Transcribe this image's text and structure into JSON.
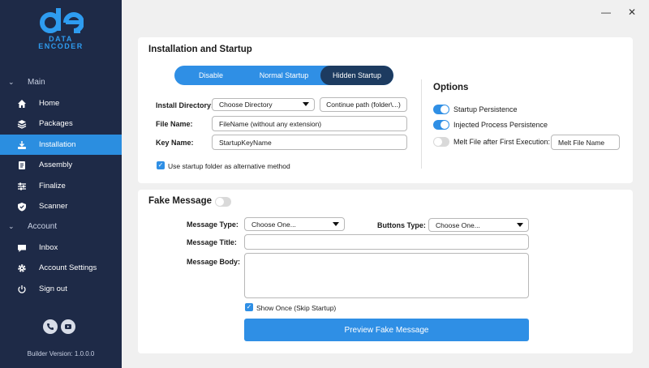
{
  "sidebar": {
    "logo_text_line1": "DATA",
    "logo_text_line2": "ENCODER",
    "section_main": "Main",
    "section_account": "Account",
    "items": [
      {
        "label": "Home",
        "icon": "home-icon"
      },
      {
        "label": "Packages",
        "icon": "layers-icon"
      },
      {
        "label": "Installation",
        "icon": "install-icon"
      },
      {
        "label": "Assembly",
        "icon": "document-icon"
      },
      {
        "label": "Finalize",
        "icon": "sliders-icon"
      },
      {
        "label": "Scanner",
        "icon": "shield-icon"
      }
    ],
    "account_items": [
      {
        "label": "Inbox",
        "icon": "chat-icon"
      },
      {
        "label": "Account Settings",
        "icon": "gear-icon"
      },
      {
        "label": "Sign out",
        "icon": "power-icon"
      }
    ],
    "version": "Builder Version: 1.0.0.0",
    "active_item": "Installation"
  },
  "install": {
    "title": "Installation and Startup",
    "startup_modes": [
      "Disable",
      "Normal Startup",
      "Hidden Startup"
    ],
    "selected_mode": "Hidden Startup",
    "install_directory_label": "Install Directory:",
    "install_directory_value": "Choose Directory",
    "continue_path_label": "Continue path (folder\\...)",
    "file_name_label": "File Name:",
    "file_name_value": "FileName (without any extension)",
    "key_name_label": "Key Name:",
    "key_name_value": "StartupKeyName",
    "startup_folder_label": "Use startup folder as alternative method",
    "startup_folder_checked": true
  },
  "options": {
    "title": "Options",
    "startup_persistence_label": "Startup Persistence",
    "startup_persistence_on": true,
    "injected_persistence_label": "Injected Process Persistence",
    "injected_persistence_on": true,
    "melt_label": "Melt File after First Execution:",
    "melt_on": false,
    "melt_name_value": "Melt File Name"
  },
  "fake_message": {
    "title": "Fake Message",
    "enabled": false,
    "message_type_label": "Message Type:",
    "message_type_value": "Choose One...",
    "buttons_type_label": "Buttons Type:",
    "buttons_type_value": "Choose One...",
    "message_title_label": "Message Title:",
    "message_title_value": "",
    "message_body_label": "Message Body:",
    "message_body_value": "",
    "show_once_label": "Show Once (Skip Startup)",
    "show_once_checked": true,
    "preview_button": "Preview Fake Message"
  },
  "colors": {
    "sidebar_bg": "#1e2a47",
    "accent": "#2f8fe5",
    "selected_segment": "#1d3b60"
  }
}
